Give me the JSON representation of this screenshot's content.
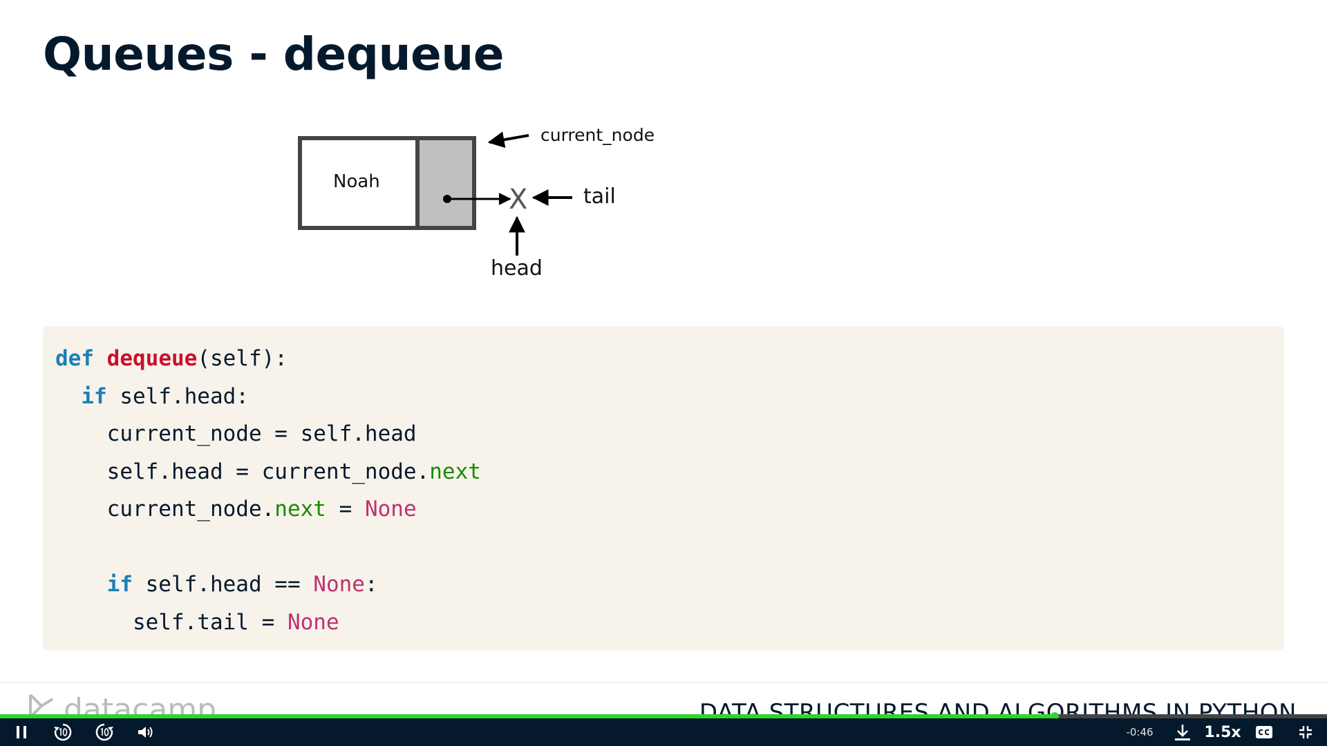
{
  "slide": {
    "title": "Queues - dequeue"
  },
  "diagram": {
    "node_value": "Noah",
    "null_marker": "X",
    "label_current_node": "current_node",
    "label_tail": "tail",
    "label_head": "head",
    "colors": {
      "box_border": "#444444",
      "pointer_fill": "#c0c0c0"
    }
  },
  "code": {
    "l1": {
      "kw": "def",
      "fn": "dequeue",
      "rest": "(self):"
    },
    "l2": {
      "kw": "if",
      "rest": " self.head:"
    },
    "l3": {
      "text": "current_node = self.head"
    },
    "l4": {
      "pre": "self.head = current_node.",
      "attr": "next"
    },
    "l5": {
      "pre": "current_node.",
      "attr": "next",
      "mid": " = ",
      "const": "None"
    },
    "l7": {
      "kw": "if",
      "pre": " self.head == ",
      "const": "None",
      "post": ":"
    },
    "l8": {
      "pre": "self.tail = ",
      "const": "None"
    },
    "colors": {
      "background": "#f7f3eb",
      "keyword": "#1d7fb5",
      "function": "#c8102e",
      "attribute": "#1b8a00",
      "constant": "#c0306e"
    }
  },
  "footer": {
    "brand": "datacamp",
    "course_title": "DATA STRUCTURES AND ALGORITHMS IN PYTHON"
  },
  "player": {
    "time_remaining": "-0:46",
    "speed": "1.5x",
    "progress_fraction": 0.795,
    "icons": [
      "pause-icon",
      "rewind-10-icon",
      "forward-10-icon",
      "volume-icon",
      "download-icon",
      "closed-captions-icon",
      "exit-fullscreen-icon"
    ],
    "colors": {
      "bar": "#05192d",
      "progress": "#2ed52b"
    }
  }
}
